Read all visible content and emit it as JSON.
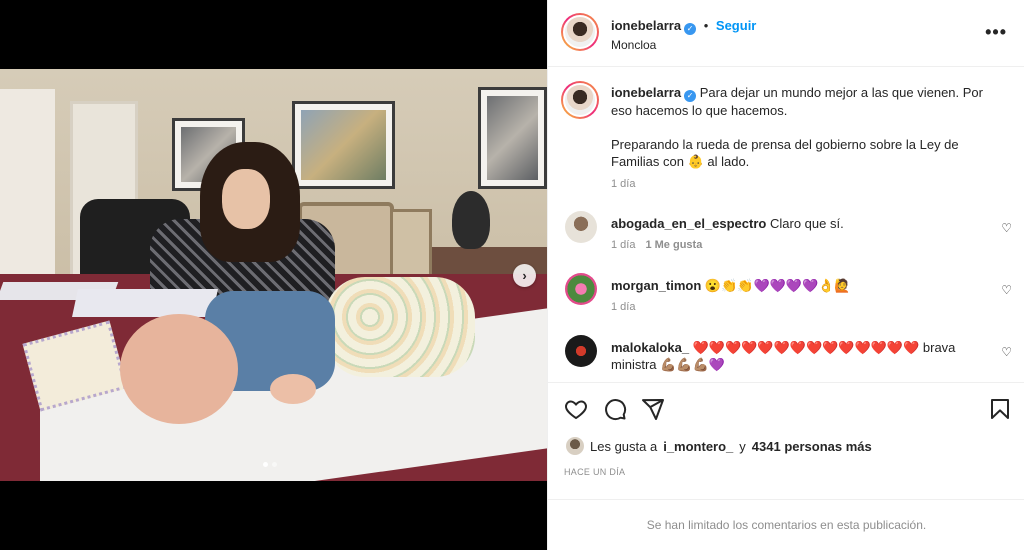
{
  "post": {
    "author": "ionebelarra",
    "follow_label": "Seguir",
    "bullet": "•",
    "location": "Moncloa",
    "more_label": "•••"
  },
  "media": {
    "next_label": "›",
    "page_count": 2,
    "active_page": 1
  },
  "caption": {
    "username": "ionebelarra",
    "line1": "Para dejar un mundo mejor a las que vienen. Por eso hacemos lo que hacemos.",
    "line2": "Preparando la rueda de prensa del gobierno sobre la Ley de Familias con 👶 al lado.",
    "time": "1 día"
  },
  "comments": [
    {
      "username": "abogada_en_el_espectro",
      "text": "Claro que sí.",
      "time": "1 día",
      "likes": "1 Me gusta"
    },
    {
      "username": "morgan_timon",
      "text": "😮👏👏💜💜💜💜👌🙋",
      "time": "1 día",
      "likes": ""
    },
    {
      "username": "malokaloka_",
      "text": "❤️❤️❤️❤️❤️❤️❤️❤️❤️❤️❤️❤️❤️❤️ brava ministra 💪🏽💪🏽💪🏽💜",
      "time": "",
      "likes": ""
    }
  ],
  "likes": {
    "prefix": "Les gusta a",
    "user": "i_montero_",
    "joiner": "y",
    "count_text": "4341 personas más"
  },
  "posted_ago": "HACE UN DÍA",
  "comments_limited": "Se han limitado los comentarios en esta publicación.",
  "colors": {
    "link": "#0095f6",
    "muted": "#8e8e8e",
    "text": "#262626",
    "verified": "#3897f0"
  },
  "icons": [
    "heart-icon",
    "comment-icon",
    "share-icon",
    "bookmark-icon",
    "more-icon",
    "verified-icon",
    "chevron-right-icon"
  ]
}
